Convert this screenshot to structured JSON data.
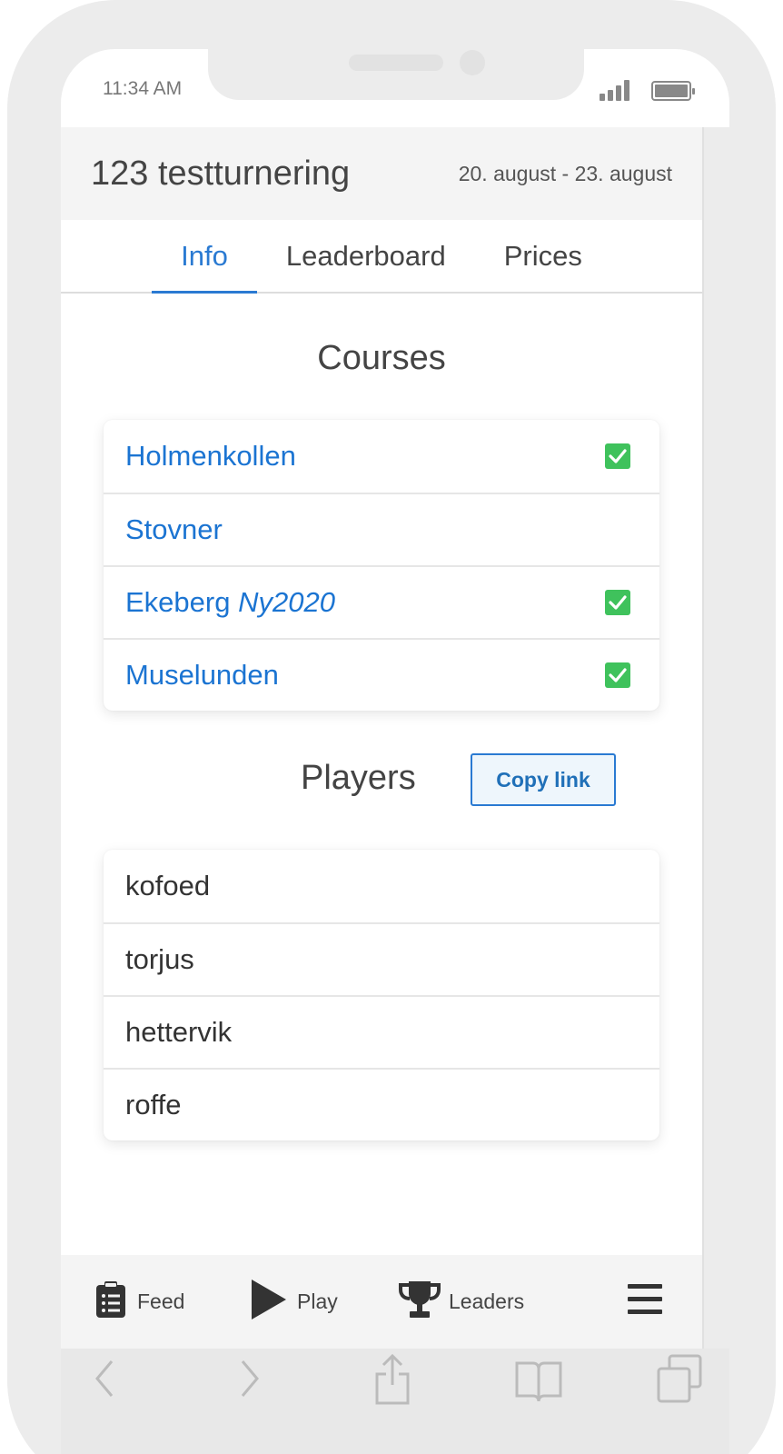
{
  "status_bar": {
    "time": "11:34 AM"
  },
  "header": {
    "title": "123 testturnering",
    "dates": "20. august - 23. august"
  },
  "tabs": [
    {
      "label": "Info",
      "active": true
    },
    {
      "label": "Leaderboard",
      "active": false
    },
    {
      "label": "Prices",
      "active": false
    }
  ],
  "courses": {
    "title": "Courses",
    "items": [
      {
        "name": "Holmenkollen",
        "suffix": "",
        "checked": true
      },
      {
        "name": "Stovner",
        "suffix": "",
        "checked": false
      },
      {
        "name": "Ekeberg",
        "suffix": "Ny2020",
        "checked": true
      },
      {
        "name": "Muselunden",
        "suffix": "",
        "checked": true
      }
    ]
  },
  "players": {
    "title": "Players",
    "copy_button": "Copy link",
    "items": [
      "kofoed",
      "torjus",
      "hettervik",
      "roffe"
    ]
  },
  "bottom_nav": {
    "feed": "Feed",
    "play": "Play",
    "leaders": "Leaders"
  },
  "colors": {
    "accent": "#2a7ad2",
    "link": "#1b74d2",
    "check": "#3fc25c"
  }
}
